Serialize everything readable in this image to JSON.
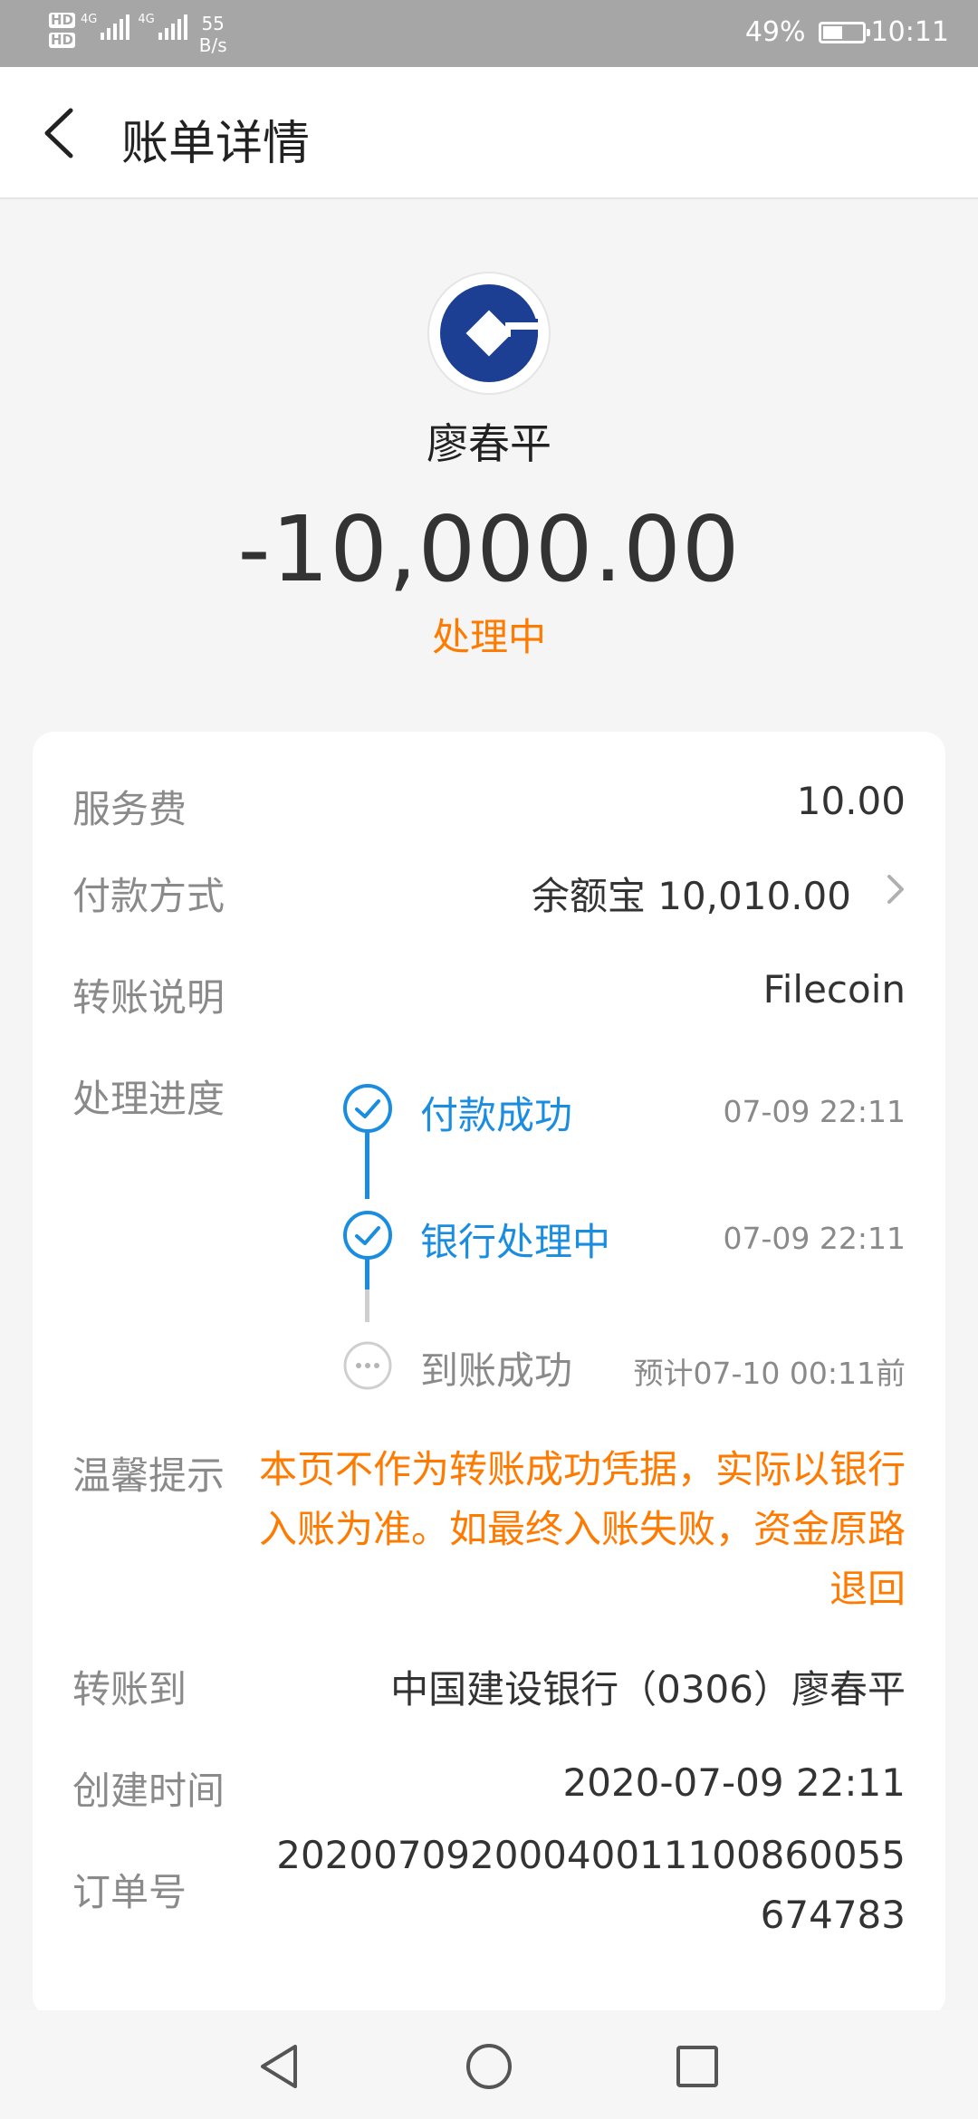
{
  "status_bar": {
    "hd1": "HD",
    "hd2": "HD",
    "net1": "4G",
    "net2": "4G",
    "speed_value": "55",
    "speed_unit": "B/s",
    "battery": "49%",
    "time": "10:11"
  },
  "header": {
    "title": "账单详情"
  },
  "payee": {
    "name": "廖春平",
    "amount": "-10,000.00",
    "status": "处理中",
    "status_color": "#ff7a00",
    "logo_color": "#1c3f94"
  },
  "details": {
    "fee_label": "服务费",
    "fee_value": "10.00",
    "payment_label": "付款方式",
    "payment_value": "余额宝 10,010.00",
    "note_label": "转账说明",
    "note_value": "Filecoin",
    "progress_label": "处理进度",
    "steps": [
      {
        "label": "付款成功",
        "time": "07-09 22:11",
        "state": "done"
      },
      {
        "label": "银行处理中",
        "time": "07-09 22:11",
        "state": "done"
      },
      {
        "label": "到账成功",
        "time": "预计07-10 00:11前",
        "state": "pending"
      }
    ],
    "tip_label": "温馨提示",
    "tip_text": "本页不作为转账成功凭据，实际以银行入账为准。如最终入账失败，资金原路退回",
    "to_label": "转账到",
    "to_value": "中国建设银行（0306）廖春平",
    "created_label": "创建时间",
    "created_value": "2020-07-09 22:11",
    "order_label": "订单号",
    "order_value": "20200709200040011100860055674783"
  },
  "colors": {
    "accent_blue": "#1b8de0",
    "accent_orange": "#ff7a00",
    "pending_gray": "#b5b5b5"
  }
}
